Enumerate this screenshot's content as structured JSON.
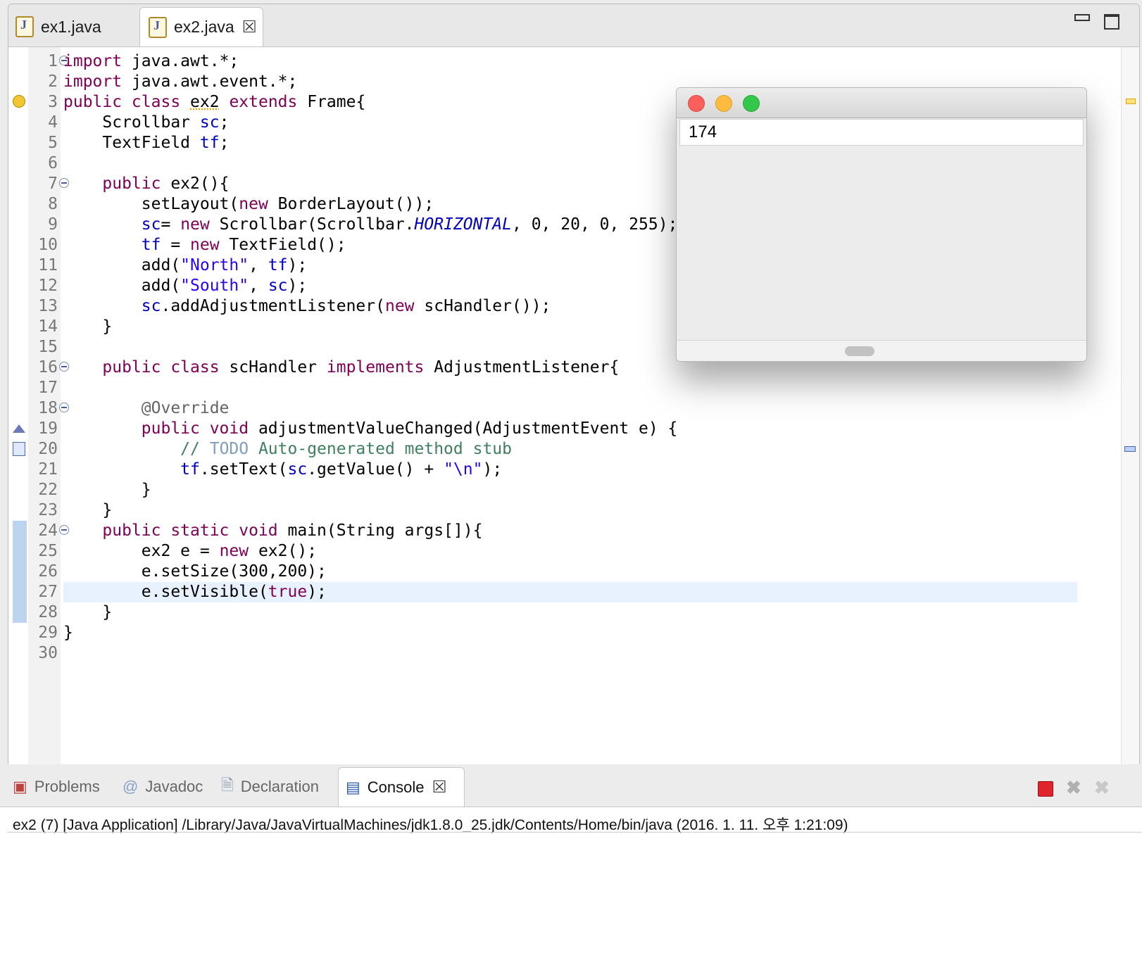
{
  "editor": {
    "tabs": [
      {
        "label": "ex1.java",
        "icon": "java-file-icon"
      },
      {
        "label": "ex2.java",
        "icon": "java-file-icon",
        "close": "⮽"
      }
    ],
    "window_buttons": {
      "minimize": "minimize-icon",
      "maximize": "maximize-icon"
    },
    "lines": [
      {
        "n": "1",
        "html": "<span class=\"kw\">import</span> java.awt.*;"
      },
      {
        "n": "2",
        "html": "<span class=\"kw\">import</span> java.awt.event.*;"
      },
      {
        "n": "3",
        "html": "<span class=\"kw\">public class</span> <span class=\"warnu\">ex2</span> <span class=\"kw\">extends</span> Frame{"
      },
      {
        "n": "4",
        "html": "    Scrollbar <span class=\"fld\">sc</span>;"
      },
      {
        "n": "5",
        "html": "    TextField <span class=\"fld\">tf</span>;"
      },
      {
        "n": "6",
        "html": ""
      },
      {
        "n": "7",
        "html": "    <span class=\"kw\">public</span> ex2(){"
      },
      {
        "n": "8",
        "html": "        setLayout(<span class=\"kw\">new</span> BorderLayout());"
      },
      {
        "n": "9",
        "html": "        <span class=\"fld\">sc</span>= <span class=\"kw\">new</span> Scrollbar(Scrollbar.<span class=\"st\">HORIZONTAL</span>, 0, 20, 0, 255);"
      },
      {
        "n": "10",
        "html": "        <span class=\"fld\">tf</span> = <span class=\"kw\">new</span> TextField();"
      },
      {
        "n": "11",
        "html": "        add(<span class=\"str\">\"North\"</span>, <span class=\"fld\">tf</span>);"
      },
      {
        "n": "12",
        "html": "        add(<span class=\"str\">\"South\"</span>, <span class=\"fld\">sc</span>);"
      },
      {
        "n": "13",
        "html": "        <span class=\"fld\">sc</span>.addAdjustmentListener(<span class=\"kw\">new</span> scHandler());"
      },
      {
        "n": "14",
        "html": "    }"
      },
      {
        "n": "15",
        "html": ""
      },
      {
        "n": "16",
        "html": "    <span class=\"kw\">public class</span> scHandler <span class=\"kw\">implements</span> AdjustmentListener{"
      },
      {
        "n": "17",
        "html": ""
      },
      {
        "n": "18",
        "html": "        <span class=\"ann\">@Override</span>"
      },
      {
        "n": "19",
        "html": "        <span class=\"kw\">public void</span> adjustmentValueChanged(AdjustmentEvent e) {"
      },
      {
        "n": "20",
        "html": "            <span class=\"cmt\">// </span><span class=\"todo\">TODO</span><span class=\"cmt\"> Auto-generated method stub</span>"
      },
      {
        "n": "21",
        "html": "            <span class=\"fld\">tf</span>.setText(<span class=\"fld\">sc</span>.getValue() + <span class=\"str\">\"\\n\"</span>);"
      },
      {
        "n": "22",
        "html": "        }"
      },
      {
        "n": "23",
        "html": "    }"
      },
      {
        "n": "24",
        "html": "    <span class=\"kw\">public static void</span> main(String args[]){"
      },
      {
        "n": "25",
        "html": "        ex2 e = <span class=\"kw\">new</span> ex2();"
      },
      {
        "n": "26",
        "html": "        e.setSize(300,200);"
      },
      {
        "n": "27",
        "html": "        e.setVisible(<span class=\"kw\">true</span>);"
      },
      {
        "n": "28",
        "html": "    }"
      },
      {
        "n": "29",
        "html": "}"
      },
      {
        "n": "30",
        "html": ""
      }
    ],
    "fold_lines": [
      "1",
      "7",
      "16",
      "18",
      "24"
    ],
    "current_line": "27"
  },
  "java_window": {
    "traffic_lights": {
      "close": "#fc605b",
      "minimize": "#fdbc40",
      "zoom": "#34c84a"
    },
    "textfield_value": "174",
    "scrollbar_value": 174,
    "scrollbar_max": 255
  },
  "views": {
    "tabs": [
      {
        "label": "Problems",
        "icon": "problems-icon"
      },
      {
        "label": "Javadoc",
        "icon": "javadoc-icon"
      },
      {
        "label": "Declaration",
        "icon": "declaration-icon"
      },
      {
        "label": "Console",
        "icon": "console-icon",
        "close": "⮽"
      }
    ],
    "console_label": "ex2 (7) [Java Application] /Library/Java/JavaVirtualMachines/jdk1.8.0_25.jdk/Contents/Home/bin/java (2016. 1. 11. 오후 1:21:09)"
  },
  "colors": {
    "keyword": "#7f0055",
    "field": "#0000c0",
    "string": "#2a00ff",
    "comment": "#3f7f5f",
    "current_line": "#e8f2fe"
  }
}
